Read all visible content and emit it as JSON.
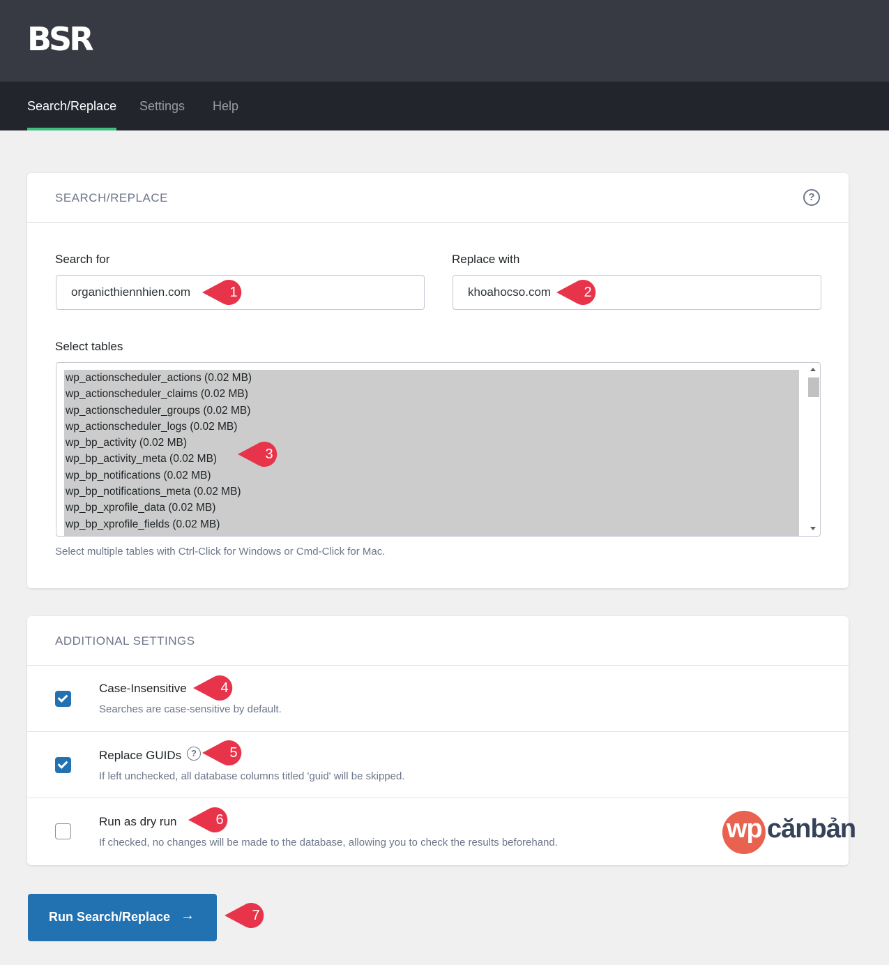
{
  "app": {
    "logo": "BSR"
  },
  "nav": {
    "tabs": [
      {
        "label": "Search/Replace",
        "active": true
      },
      {
        "label": "Settings",
        "active": false
      },
      {
        "label": "Help",
        "active": false
      }
    ]
  },
  "search_replace": {
    "title": "SEARCH/REPLACE",
    "help_icon": "question-circle-icon",
    "search_label": "Search for",
    "search_value": "organicthiennhien.com",
    "replace_label": "Replace with",
    "replace_value": "khoahocso.com",
    "tables_label": "Select tables",
    "tables": [
      "wp_actionscheduler_actions (0.02 MB)",
      "wp_actionscheduler_claims (0.02 MB)",
      "wp_actionscheduler_groups (0.02 MB)",
      "wp_actionscheduler_logs (0.02 MB)",
      "wp_bp_activity (0.02 MB)",
      "wp_bp_activity_meta (0.02 MB)",
      "wp_bp_notifications (0.02 MB)",
      "wp_bp_notifications_meta (0.02 MB)",
      "wp_bp_xprofile_data (0.02 MB)",
      "wp_bp_xprofile_fields (0.02 MB)"
    ],
    "tables_hint": "Select multiple tables with Ctrl-Click for Windows or Cmd-Click for Mac."
  },
  "additional_settings": {
    "title": "ADDITIONAL SETTINGS",
    "options": [
      {
        "label": "Case-Insensitive",
        "description": "Searches are case-sensitive by default.",
        "checked": true
      },
      {
        "label": "Replace GUIDs",
        "description": "If left unchecked, all database columns titled 'guid' will be skipped.",
        "checked": true,
        "help_icon": "question-circle-icon"
      },
      {
        "label": "Run as dry run",
        "description": "If checked, no changes will be made to the database, allowing you to check the results beforehand.",
        "checked": false
      }
    ]
  },
  "run_button": {
    "label": "Run Search/Replace",
    "icon": "arrow-right-icon",
    "arrow": "→"
  },
  "markers": [
    "1",
    "2",
    "3",
    "4",
    "5",
    "6",
    "7"
  ],
  "watermark": {
    "prefix": "wp",
    "text": "cănbản"
  },
  "colors": {
    "topbar": "#373943",
    "navbar": "#23252d",
    "active_tab_underline": "#3fbf7f",
    "primary": "#2271b1",
    "marker": "#e8344a",
    "watermark_circle": "#e8624f"
  }
}
